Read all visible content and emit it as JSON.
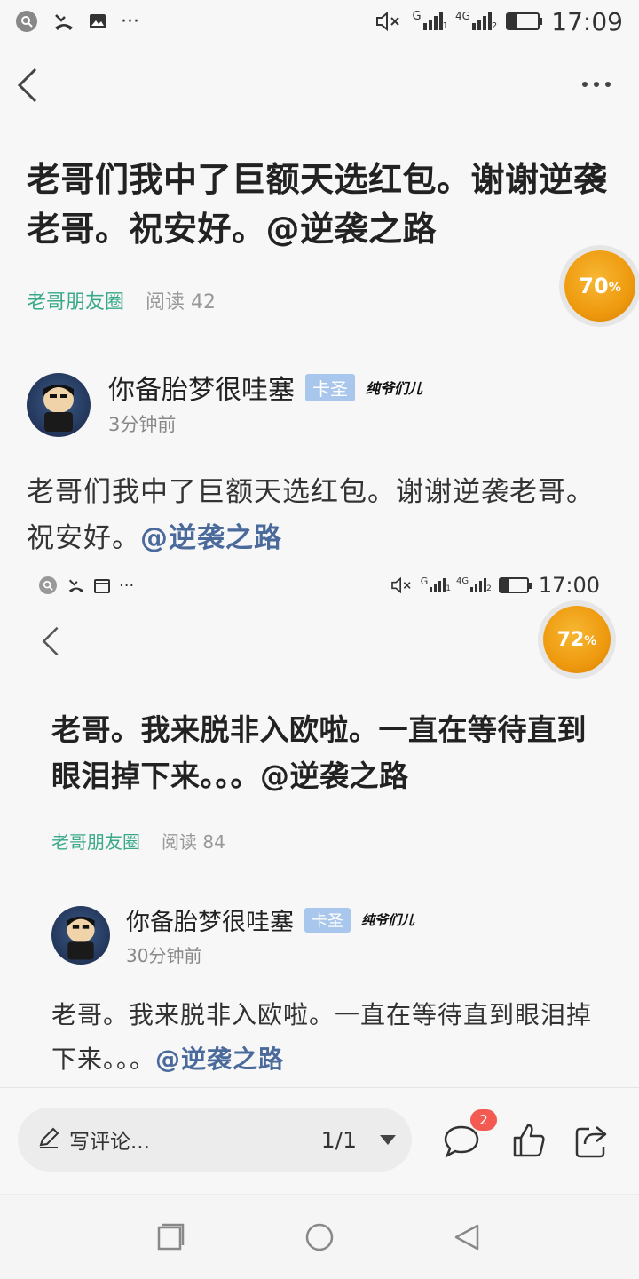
{
  "status_bar_top": {
    "time": "17:09",
    "net_g": "G",
    "net_4g": "4G",
    "sim1": "1",
    "sim2": "2"
  },
  "status_bar_inner": {
    "time": "17:00",
    "net_g": "G",
    "net_4g": "4G",
    "sim1": "1",
    "sim2": "2"
  },
  "post1": {
    "title": "老哥们我中了巨额天选红包。谢谢逆袭老哥。祝安好。@逆袭之路",
    "tag": "老哥朋友圈",
    "reads": "阅读 42",
    "progress_badge": "70",
    "progress_unit": "%",
    "author": "你备胎梦很哇塞",
    "level": "卡圣",
    "signature": "纯爷们儿",
    "time_ago": "3分钟前",
    "body": "老哥们我中了巨额天选红包。谢谢逆袭老哥。祝安好。",
    "mention": "@逆袭之路"
  },
  "post2": {
    "title": "老哥。我来脱非入欧啦。一直在等待直到眼泪掉下来。。。@逆袭之路",
    "tag": "老哥朋友圈",
    "reads": "阅读 84",
    "progress_badge": "72",
    "progress_unit": "%",
    "author": "你备胎梦很哇塞",
    "level": "卡圣",
    "signature": "纯爷们儿",
    "time_ago": "30分钟前",
    "body": "老哥。我来脱非入欧啦。一直在等待直到眼泪掉下来。。。",
    "mention": "@逆袭之路"
  },
  "bottom_bar": {
    "comment_placeholder": "写评论...",
    "pager": "1/1",
    "comment_count": "2"
  },
  "icons": [
    "search-icon",
    "missed-call-icon",
    "image-icon",
    "more-icon",
    "mute-icon",
    "signal-icon",
    "battery-icon",
    "back-icon",
    "more-dots-icon",
    "pencil-icon",
    "comment-icon",
    "like-icon",
    "share-icon",
    "recent-apps-icon",
    "home-icon",
    "back-nav-icon"
  ],
  "colors": {
    "accent_tag": "#3aa98a",
    "mention": "#4b6a9c",
    "badge_orange": "#ee9a0e",
    "level_badge": "#a9c6ec",
    "count_badge": "#f25a52"
  }
}
